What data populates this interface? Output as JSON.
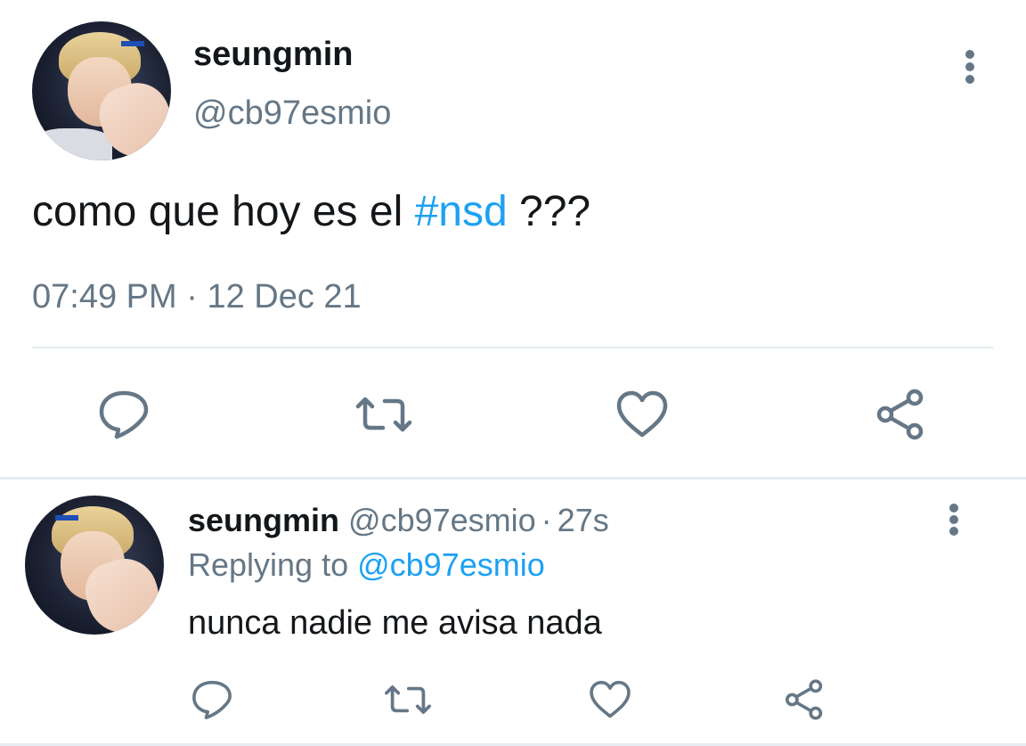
{
  "main_tweet": {
    "display_name": "seungmin",
    "handle": "@cb97esmio",
    "text_before": "como que hoy es el ",
    "hashtag": "#nsd",
    "text_after": " ???",
    "time": "07:49 PM",
    "meta_separator": " · ",
    "date": "12 Dec 21"
  },
  "reply_tweet": {
    "display_name": "seungmin",
    "handle": "@cb97esmio",
    "separator": "·",
    "age": "27s",
    "replying_label": "Replying to ",
    "replying_to": "@cb97esmio",
    "text": "nunca nadie me avisa nada"
  },
  "colors": {
    "text": "#14171a",
    "secondary": "#657786",
    "accent": "#1da1f2",
    "divider": "#e6ecf0"
  },
  "icons": {
    "more": "more-vertical-icon",
    "reply": "reply-bubble-icon",
    "retweet": "retweet-icon",
    "like": "heart-icon",
    "share": "share-icon"
  }
}
